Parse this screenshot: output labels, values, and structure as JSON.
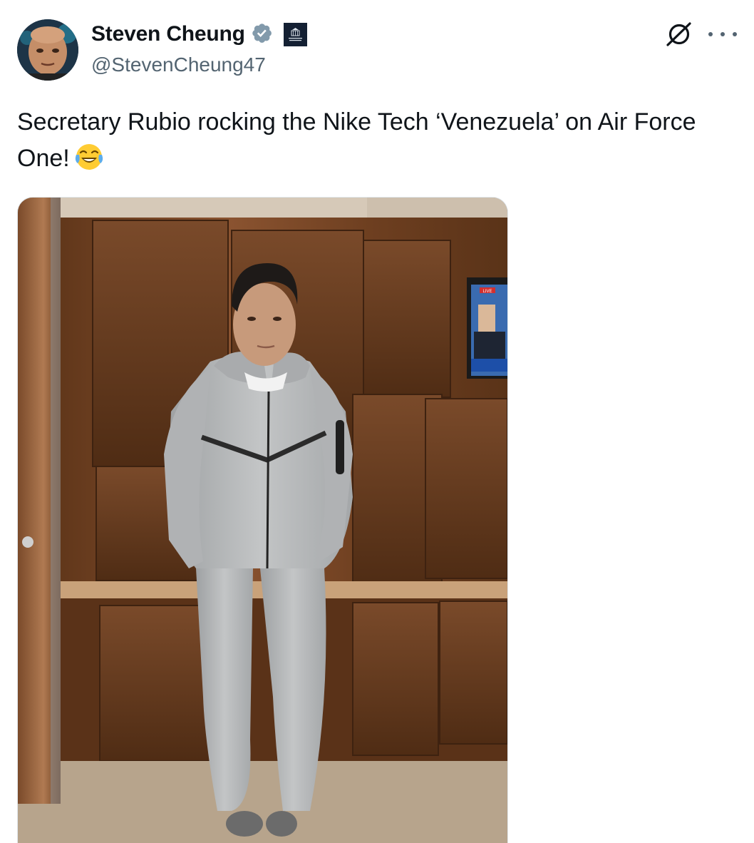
{
  "tweet": {
    "author": {
      "display_name": "Steven Cheung",
      "handle": "@StevenCheung47",
      "verified_badge_icon": "verified-badge-icon",
      "affiliation_badge_icon": "white-house-badge-icon",
      "affiliation_badge_text": "WHITE HOUSE"
    },
    "text": "Secretary Rubio rocking the Nike Tech ‘Venezuela’ on Air Force One!",
    "emoji_icon": "face-with-tears-of-joy-icon",
    "actions": {
      "grok_icon": "grok-icon",
      "more_icon": "more-options-icon"
    },
    "media": {
      "type": "photo",
      "tv_badge": "LIVE"
    }
  },
  "colors": {
    "text_primary": "#0f1419",
    "text_secondary": "#536471",
    "verified_blue": "#829aab",
    "background": "#ffffff"
  }
}
